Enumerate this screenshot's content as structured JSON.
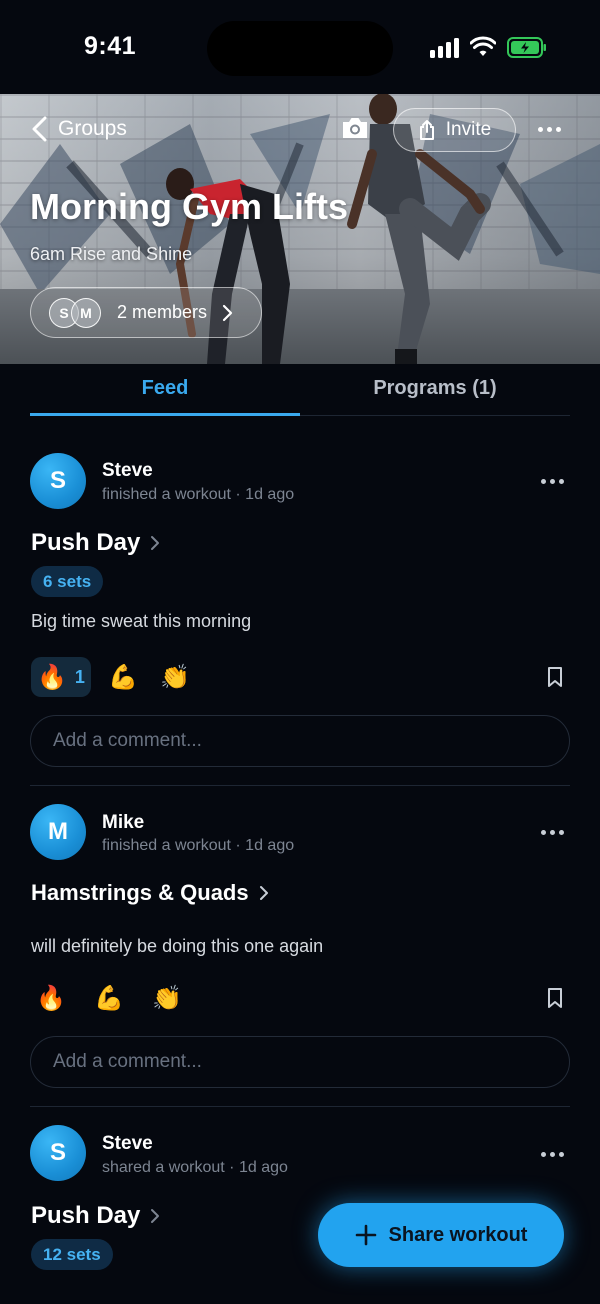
{
  "status_bar": {
    "time": "9:41"
  },
  "header": {
    "back_label": "Groups",
    "invite_label": "Invite",
    "group_title": "Morning Gym Lifts",
    "group_subtitle": "6am Rise and Shine",
    "members": {
      "initials": [
        "S",
        "M"
      ],
      "label": "2 members"
    }
  },
  "tabs": [
    {
      "label": "Feed",
      "active": true
    },
    {
      "label": "Programs (1)",
      "active": false
    }
  ],
  "posts": [
    {
      "avatar_initial": "S",
      "username": "Steve",
      "meta": "finished a workout · 1d ago",
      "workout_title": "Push Day",
      "sets": "6 sets",
      "caption": "Big time sweat this morning",
      "reactions": [
        {
          "emoji": "🔥",
          "count": "1",
          "active": true
        },
        {
          "emoji": "💪",
          "count": "",
          "active": false
        },
        {
          "emoji": "👏",
          "count": "",
          "active": false
        }
      ],
      "comment_placeholder": "Add a comment..."
    },
    {
      "avatar_initial": "M",
      "username": "Mike",
      "meta": "finished a workout · 1d ago",
      "workout_title": "Hamstrings & Quads",
      "sets": "",
      "caption": "will definitely be doing this one again",
      "reactions": [
        {
          "emoji": "🔥",
          "count": "",
          "active": false
        },
        {
          "emoji": "💪",
          "count": "",
          "active": false
        },
        {
          "emoji": "👏",
          "count": "",
          "active": false
        }
      ],
      "comment_placeholder": "Add a comment..."
    },
    {
      "avatar_initial": "S",
      "username": "Steve",
      "meta": "shared a workout · 1d ago",
      "workout_title": "Push Day",
      "sets": "12 sets",
      "caption": "",
      "reactions": [],
      "comment_placeholder": ""
    }
  ],
  "fab": {
    "label": "Share workout"
  },
  "colors": {
    "accent": "#22a3ef",
    "background": "#05080f",
    "badge_bg": "#0f2b45"
  },
  "icons": [
    "signal-icon",
    "wifi-icon",
    "battery-icon",
    "chevron-left-icon",
    "camera-icon",
    "share-icon",
    "more-icon",
    "chevron-right-icon",
    "bookmark-icon",
    "plus-icon"
  ]
}
